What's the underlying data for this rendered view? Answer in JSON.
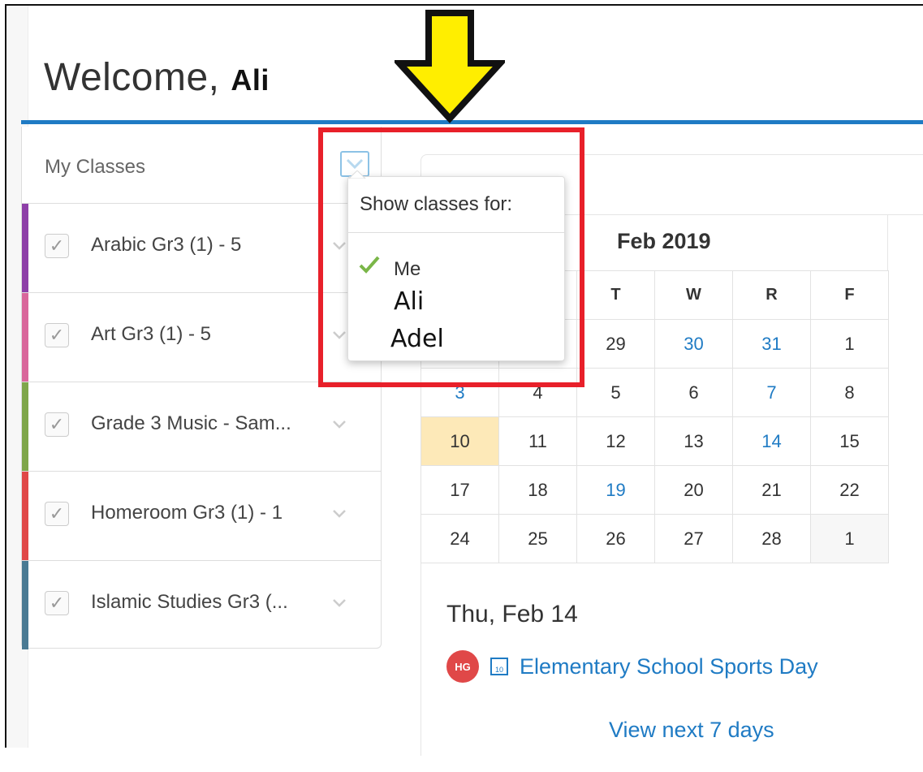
{
  "header": {
    "welcome_prefix": "Welcome,",
    "user_name": "Ali"
  },
  "classes": {
    "title": "My Classes",
    "items": [
      {
        "label": "Arabic Gr3 (1) - 5",
        "color": "#8e3fa8"
      },
      {
        "label": "Art Gr3 (1) - 5",
        "color": "#d9679b"
      },
      {
        "label": "Grade 3 Music - Sam...",
        "color": "#7fa64a"
      },
      {
        "label": "Homeroom Gr3 (1) - 1",
        "color": "#e04848"
      },
      {
        "label": "Islamic Studies Gr3 (...",
        "color": "#4a7a93"
      }
    ]
  },
  "popup": {
    "title": "Show classes for:",
    "options": [
      {
        "label": "Me",
        "selected": true
      },
      {
        "label": "Ali",
        "selected": false
      },
      {
        "label": "Adel",
        "selected": false
      }
    ]
  },
  "calendar": {
    "month": "Feb 2019",
    "weekdays": [
      "T",
      "W",
      "R",
      "F"
    ],
    "rows": [
      [
        "",
        "",
        "29",
        "30",
        "31",
        "1"
      ],
      [
        "3",
        "4",
        "5",
        "6",
        "7",
        "8"
      ],
      [
        "10",
        "11",
        "12",
        "13",
        "14",
        "15"
      ],
      [
        "17",
        "18",
        "19",
        "20",
        "21",
        "22"
      ],
      [
        "24",
        "25",
        "26",
        "27",
        "28",
        "1"
      ]
    ]
  },
  "agenda": {
    "day_header": "Thu, Feb 14",
    "event_avatar": "HG",
    "event_icon_text": "10",
    "event_title": "Elementary School Sports Day",
    "view_next": "View next 7 days"
  },
  "colors": {
    "accent": "#1f7bc4",
    "highlight": "#e8202a",
    "arrow": "#ffee00",
    "today": "#fde9b8"
  }
}
